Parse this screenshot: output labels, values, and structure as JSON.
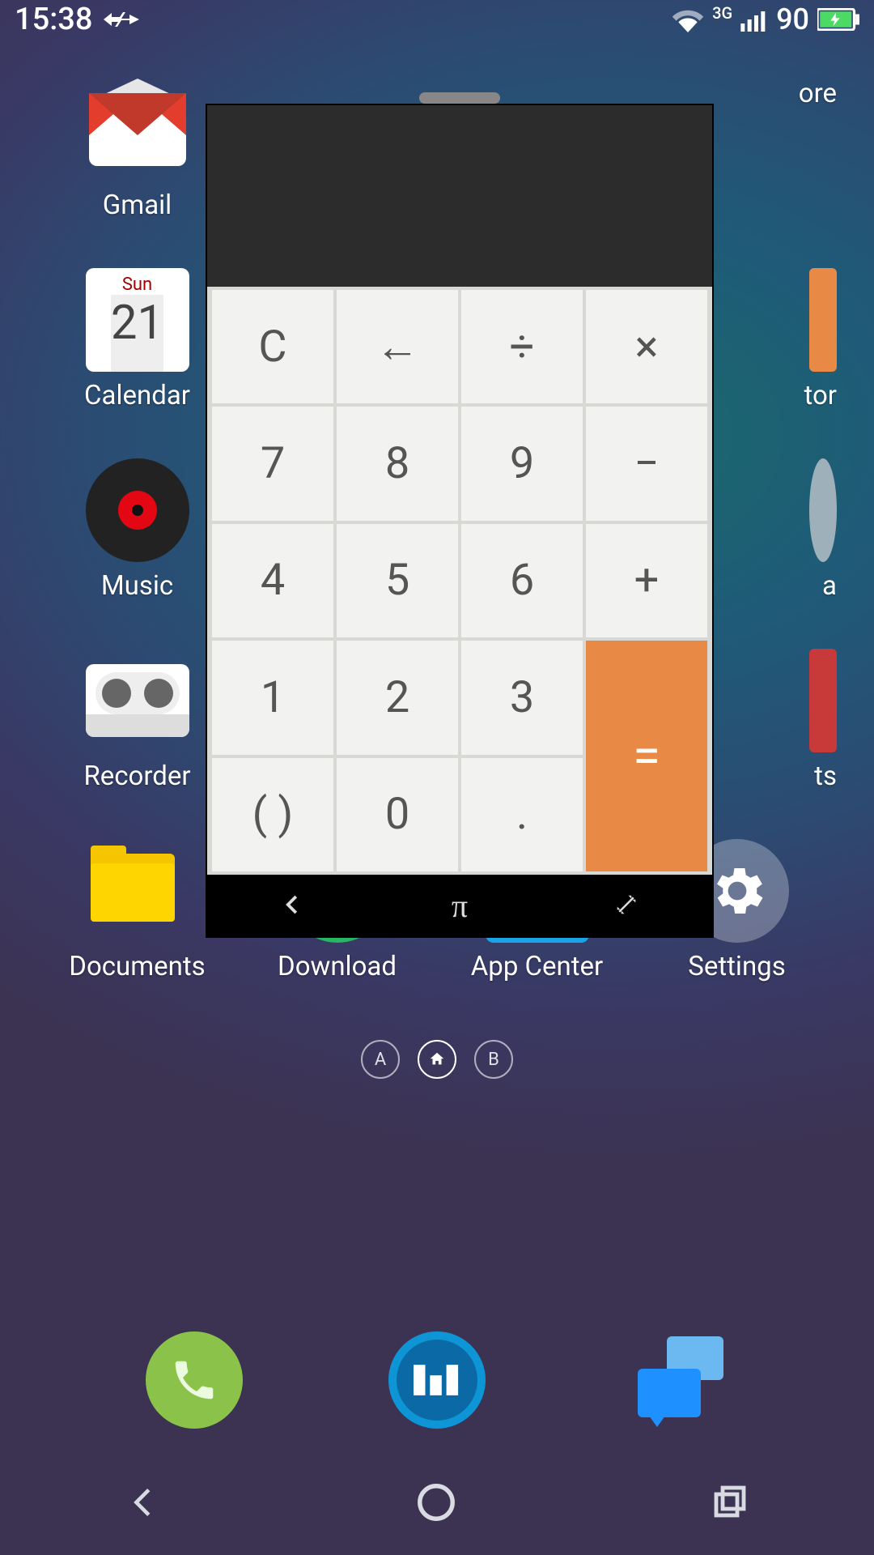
{
  "status": {
    "time": "15:38",
    "battery": "90",
    "net_label": "3G"
  },
  "calendar_icon": {
    "dow": "Sun",
    "day": "21"
  },
  "apps": {
    "gmail": "Gmail",
    "calendar": "Calendar",
    "music": "Music",
    "recorder": "Recorder",
    "documents": "Documents",
    "download": "Download",
    "appcenter": "App Center",
    "settings": "Settings",
    "partial_top": "ore",
    "partial_2": "tor",
    "partial_3": "a",
    "partial_4": "ts"
  },
  "page_indicator": {
    "left": "A",
    "right": "B"
  },
  "calc": {
    "keys": {
      "clear": "C",
      "back": "←",
      "div": "÷",
      "mul": "×",
      "k7": "7",
      "k8": "8",
      "k9": "9",
      "sub": "−",
      "k4": "4",
      "k5": "5",
      "k6": "6",
      "add": "+",
      "k1": "1",
      "k2": "2",
      "k3": "3",
      "par": "( )",
      "k0": "0",
      "dot": ".",
      "eq": "="
    },
    "bottom": {
      "back": "❮",
      "pi": "π",
      "expand": "⤢"
    }
  }
}
